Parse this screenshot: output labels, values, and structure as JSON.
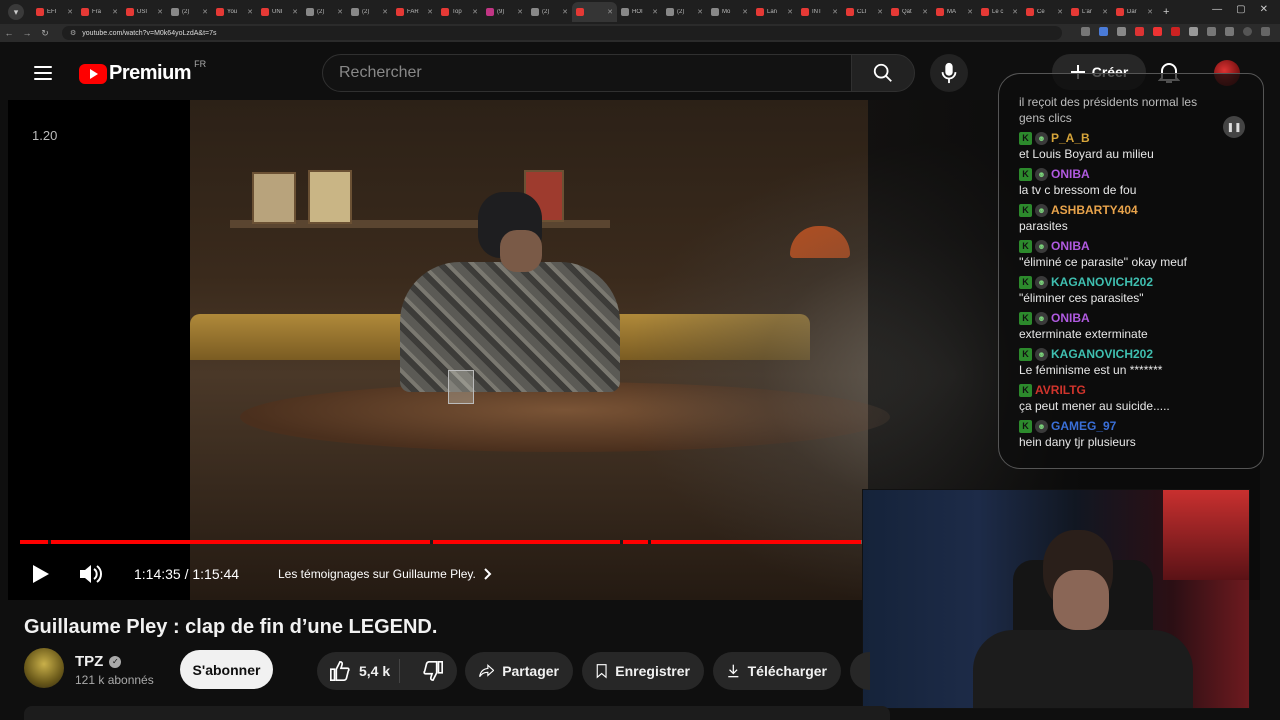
{
  "browser": {
    "tabs": [
      {
        "label": "EFI",
        "color": "#e53935"
      },
      {
        "label": "Fra",
        "color": "#e53935"
      },
      {
        "label": "USI",
        "color": "#e53935"
      },
      {
        "label": "(2)",
        "color": "#888888"
      },
      {
        "label": "You",
        "color": "#e53935"
      },
      {
        "label": "UNI",
        "color": "#e53935"
      },
      {
        "label": "(2)",
        "color": "#888888"
      },
      {
        "label": "(2)",
        "color": "#888888"
      },
      {
        "label": "FAR",
        "color": "#e53935"
      },
      {
        "label": "Top",
        "color": "#e53935"
      },
      {
        "label": "(9)",
        "color": "#c13584"
      },
      {
        "label": "(2)",
        "color": "#888888"
      },
      {
        "label": "",
        "color": "#e53935"
      },
      {
        "label": "HOI",
        "color": "#888888"
      },
      {
        "label": "(2)",
        "color": "#888888"
      },
      {
        "label": "Mo",
        "color": "#888888"
      },
      {
        "label": "Lan",
        "color": "#e53935"
      },
      {
        "label": "INT",
        "color": "#e53935"
      },
      {
        "label": "CLI",
        "color": "#e53935"
      },
      {
        "label": "Qat",
        "color": "#e53935"
      },
      {
        "label": "MA",
        "color": "#e53935"
      },
      {
        "label": "Le c",
        "color": "#e53935"
      },
      {
        "label": "Ce",
        "color": "#e53935"
      },
      {
        "label": "L'ar",
        "color": "#e53935"
      },
      {
        "label": "Dar",
        "color": "#e53935"
      }
    ],
    "url": "youtube.com/watch?v=M0k64yoLzdA&t=7s",
    "new_tab": "+",
    "win_min": "—",
    "win_max": "▢",
    "win_close": "✕"
  },
  "header": {
    "logo_text": "Premium",
    "logo_region": "FR",
    "search_placeholder": "Rechercher",
    "create_label": "Créer"
  },
  "video": {
    "speed_label": "1.20",
    "progress_fraction": 0.6893,
    "time_display": "1:14:35 / 1:15:44",
    "chapter": "Les témoignages sur Guillaume Pley."
  },
  "chat": {
    "top_text_1": "il reçoit des présidents normal les",
    "top_text_2": "gens clics",
    "messages": [
      {
        "user": "P_A_B",
        "color": "#d7a53a",
        "text": "et Louis Boyard au milieu"
      },
      {
        "user": "ONIBA",
        "color": "#b05ae0",
        "text": "la tv c bressom de fou"
      },
      {
        "user": "ASHBARTY404",
        "color": "#e8a34b",
        "text": "parasites"
      },
      {
        "user": "ONIBA",
        "color": "#b05ae0",
        "text": "''éliminé ce parasite'' okay meuf"
      },
      {
        "user": "KAGANOVICH202",
        "color": "#3fbfb0",
        "text": "\"éliminer ces parasites\""
      },
      {
        "user": "ONIBA",
        "color": "#b05ae0",
        "text": "exterminate exterminate"
      },
      {
        "user": "KAGANOVICH202",
        "color": "#3fbfb0",
        "text": "Le féminisme est un *******"
      },
      {
        "user": "AVRILTG",
        "color": "#d0342c",
        "text": "ça peut mener au suicide....."
      },
      {
        "user": "GAMEG_97",
        "color": "#3a6fd8",
        "text": "hein dany tjr plusieurs"
      }
    ]
  },
  "details": {
    "title": "Guillaume Pley : clap de fin d’une LEGEND.",
    "channel_name": "TPZ",
    "subscribers": "121 k abonnés",
    "subscribe_label": "S'abonner",
    "likes": "5,4 k",
    "share_label": "Partager",
    "save_label": "Enregistrer",
    "download_label": "Télécharger"
  }
}
